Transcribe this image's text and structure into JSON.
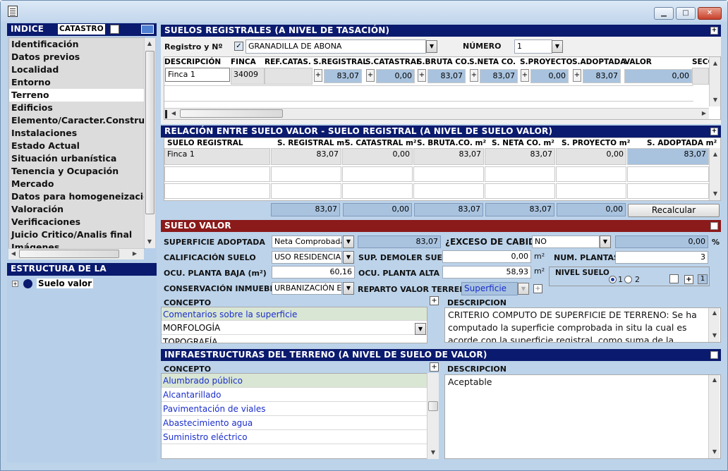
{
  "window": {
    "minimize": "▁",
    "maximize": "□",
    "close": "✕"
  },
  "indice": {
    "title": "INDICE",
    "catastro_label": "CATASTRO",
    "items": [
      "Identificación",
      "Datos previos",
      "Localidad",
      "Entorno",
      "Terreno",
      "Edificios",
      "Elemento/Caracter.Constructivas",
      "Instalaciones",
      "Estado Actual",
      "Situación urbanística",
      "Tenencia y Ocupación",
      "Mercado",
      "Datos para homogeneización",
      "Valoración",
      "Verificaciones",
      "Juicio Critico/Analis final",
      "Imágenes"
    ],
    "selected": "Terreno"
  },
  "estructura": {
    "title": "ESTRUCTURA DE LA TASACION",
    "node": "Suelo valor"
  },
  "suelos_registrales": {
    "title": "SUELOS REGISTRALES (A NIVEL DE TASACIÓN)",
    "registro_label": "Registro y Nº",
    "registro_value": "GRANADILLA DE ABONA",
    "numero_label": "NÚMERO",
    "numero_value": "1",
    "columns": [
      "DESCRIPCIÓN",
      "FINCA",
      "REF.CATAS.",
      "S.REGISTRAL",
      "S.CATASTRAL",
      "S.BRUTA CO.",
      "S.NETA CO.",
      "S.PROYECTO",
      "S.ADOPTADA",
      "VALOR",
      "SECC"
    ],
    "row": {
      "descripcion": "Finca 1",
      "finca": "34009",
      "ref": "",
      "s_registral": "83,07",
      "s_catastral": "0,00",
      "s_bruta": "83,07",
      "s_neta": "83,07",
      "s_proyecto": "0,00",
      "s_adoptada": "83,07",
      "valor": "0,00"
    }
  },
  "relacion": {
    "title": "RELACIÓN ENTRE SUELO VALOR - SUELO REGISTRAL (A NIVEL DE SUELO VALOR)",
    "columns": [
      "SUELO REGISTRAL",
      "S. REGISTRAL m²",
      "S. CATASTRAL m²",
      "S. BRUTA.CO. m²",
      "S. NETA CO. m²",
      "S. PROYECTO m²",
      "S. ADOPTADA m²"
    ],
    "row": [
      "Finca 1",
      "83,07",
      "0,00",
      "83,07",
      "83,07",
      "0,00",
      "83,07"
    ],
    "totals": [
      "83,07",
      "0,00",
      "83,07",
      "83,07",
      "0,00"
    ],
    "recalcular": "Recalcular"
  },
  "suelo_valor": {
    "title": "SUELO VALOR",
    "superficie_label": "SUPERFICIE ADOPTADA",
    "superficie_tipo": "Neta Comprobada",
    "superficie_valor": "83,07",
    "exceso_label": "¿EXCESO DE CABIDA?",
    "exceso_value": "NO",
    "exceso_pct": "0,00",
    "pct": "%",
    "calificacion_label": "CALIFICACIÓN SUELO",
    "calificacion_value": "USO RESIDENCIAL",
    "demoler_label": "SUP. DEMOLER SUELO",
    "demoler_value": "0,00",
    "m2": "m²",
    "plantas_label": "NUM. PLANTAS",
    "plantas_value": "3",
    "ocu_baja_label": "OCU. PLANTA BAJA (m²)",
    "ocu_baja_value": "60,16",
    "ocu_alta_label": "OCU. PLANTA ALTA",
    "ocu_alta_value": "58,93",
    "nivel_label": "NIVEL SUELO",
    "nivel_opt1": "1",
    "nivel_opt2": "2",
    "nivel_num": "1",
    "conservacion_label": "CONSERVACIÓN INMUEBLE",
    "conservacion_value": "URBANIZACIÓN EN",
    "reparto_label": "REPARTO VALOR TERRENO",
    "reparto_value": "Superficie",
    "concepto_label": "CONCEPTO",
    "descripcion_label": "DESCRIPCION",
    "conceptos": [
      "Comentarios sobre la superficie",
      "MORFOLOGÍA",
      "TOPOGRAFÍA"
    ],
    "descripcion": "CRITERIO COMPUTO DE SUPERFICIE DE TERRENO: Se ha computado la superficie comprobada in situ la cual es acorde con la superficie registral, como suma de la ocupación en"
  },
  "infra": {
    "title": "INFRAESTRUCTURAS DEL TERRENO (A NIVEL DE SUELO DE VALOR)",
    "concepto_label": "CONCEPTO",
    "descripcion_label": "DESCRIPCION",
    "items": [
      "Alumbrado público",
      "Alcantarillado",
      "Pavimentación de viales",
      "Abastecimiento agua",
      "Suministro eléctrico"
    ],
    "descripcion": "Aceptable"
  }
}
